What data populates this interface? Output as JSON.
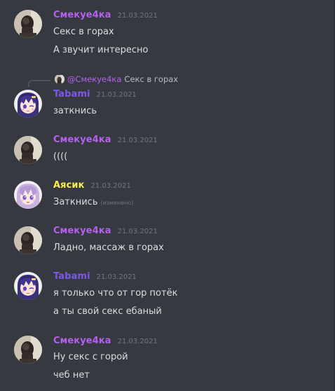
{
  "colors": {
    "background": "#36393f",
    "purple_name": "#b660f0",
    "indigo_name": "#7b59e6",
    "yellow_name": "#f7ee4a",
    "timestamp": "#72767d",
    "message_text": "#dcddde"
  },
  "reply": {
    "mention": "@Смекуе4ка",
    "quote": "Секс в горах",
    "avatar_icon": "reply-avatar-icon"
  },
  "messages": [
    {
      "author": "Смекуе4ка",
      "timestamp": "21.03.2021",
      "avatar_icon": "dark-photo-avatar",
      "lines": [
        "Секс в горах",
        "А звучит интересно"
      ]
    },
    {
      "author": "Tabami",
      "timestamp": "21.03.2021",
      "avatar_icon": "anime-girl-avatar",
      "lines": [
        "заткнись"
      ]
    },
    {
      "author": "Смекуе4ка",
      "timestamp": "21.03.2021",
      "avatar_icon": "dark-photo-avatar",
      "lines": [
        "(((("
      ]
    },
    {
      "author": "Аясик",
      "timestamp": "21.03.2021",
      "avatar_icon": "anime-lilac-avatar",
      "lines": [
        "Заткнись"
      ],
      "edited": "(изменено)"
    },
    {
      "author": "Смекуе4ка",
      "timestamp": "21.03.2021",
      "avatar_icon": "dark-photo-avatar",
      "lines": [
        "Ладно, массаж в горах"
      ]
    },
    {
      "author": "Tabami",
      "timestamp": "21.03.2021",
      "avatar_icon": "anime-girl-avatar",
      "lines": [
        "я только что от гор потёк",
        "а ты свой секс ебаный"
      ]
    },
    {
      "author": "Смекуе4ка",
      "timestamp": "21.03.2021",
      "avatar_icon": "dark-photo-avatar",
      "lines": [
        "Ну секс с горой",
        "чеб нет"
      ]
    }
  ]
}
